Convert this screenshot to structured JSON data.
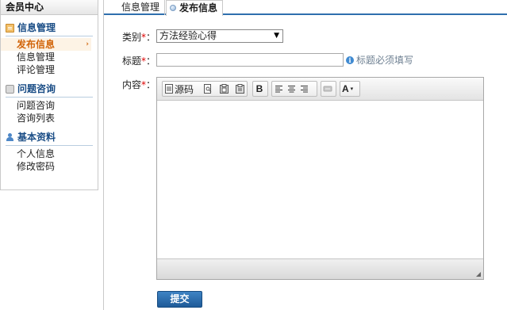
{
  "sidebar": {
    "title": "会员中心",
    "sections": [
      {
        "title": "信息管理",
        "icon": "document-icon",
        "items": [
          {
            "label": "发布信息",
            "active": true
          },
          {
            "label": "信息管理",
            "active": false
          },
          {
            "label": "评论管理",
            "active": false
          }
        ]
      },
      {
        "title": "问题咨询",
        "icon": "chat-icon",
        "items": [
          {
            "label": "问题咨询",
            "active": false
          },
          {
            "label": "咨询列表",
            "active": false
          }
        ]
      },
      {
        "title": "基本资料",
        "icon": "user-icon",
        "items": [
          {
            "label": "个人信息",
            "active": false
          },
          {
            "label": "修改密码",
            "active": false
          }
        ]
      }
    ]
  },
  "tabs": [
    {
      "label": "信息管理",
      "active": false
    },
    {
      "label": "发布信息",
      "active": true
    }
  ],
  "form": {
    "category_label": "类别",
    "category_value": "方法经验心得",
    "title_label": "标题",
    "title_value": "",
    "title_hint": "标题必须填写",
    "content_label": "内容",
    "required_mark": "*",
    "colon": "：",
    "submit_label": "提交"
  },
  "editor": {
    "toolbar": {
      "source_label": "源码",
      "bold_label": "B",
      "font_color_label": "A"
    }
  },
  "colors": {
    "accent": "#2f6fae",
    "active_item": "#d2650a",
    "section_title": "#1a4d86",
    "required": "#dd0000"
  }
}
